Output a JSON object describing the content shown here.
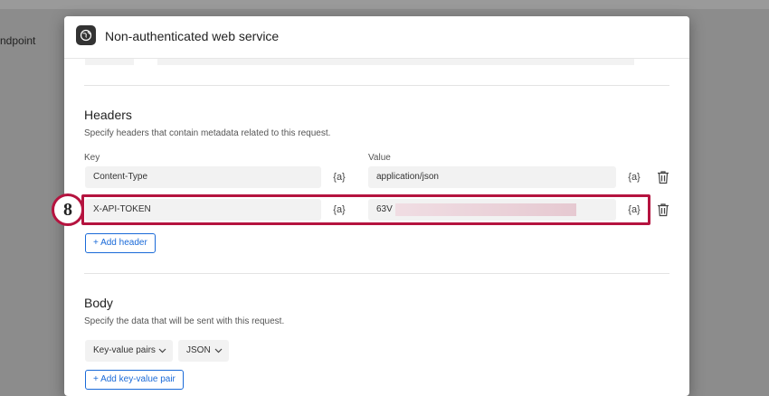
{
  "backdrop": {
    "partial_text": "ndpoint"
  },
  "modal": {
    "title": "Non-authenticated web service",
    "icon": "globe-icon"
  },
  "headers_section": {
    "title": "Headers",
    "description": "Specify headers that contain metadata related to this request.",
    "key_label": "Key",
    "value_label": "Value",
    "variable_button": "{a}",
    "rows": [
      {
        "key": "Content-Type",
        "value": "application/json"
      },
      {
        "key": "X-API-TOKEN",
        "value": "63V"
      }
    ],
    "add_button": "+ Add header"
  },
  "body_section": {
    "title": "Body",
    "description": "Specify the data that will be sent with this request.",
    "format_selected": "Key-value pairs",
    "type_selected": "JSON",
    "add_button": "+ Add key-value pair"
  },
  "annotation": {
    "step_number": "8",
    "color": "#b5133f"
  },
  "colors": {
    "accent": "#1a6ad8",
    "field_bg": "#f2f2f2"
  }
}
